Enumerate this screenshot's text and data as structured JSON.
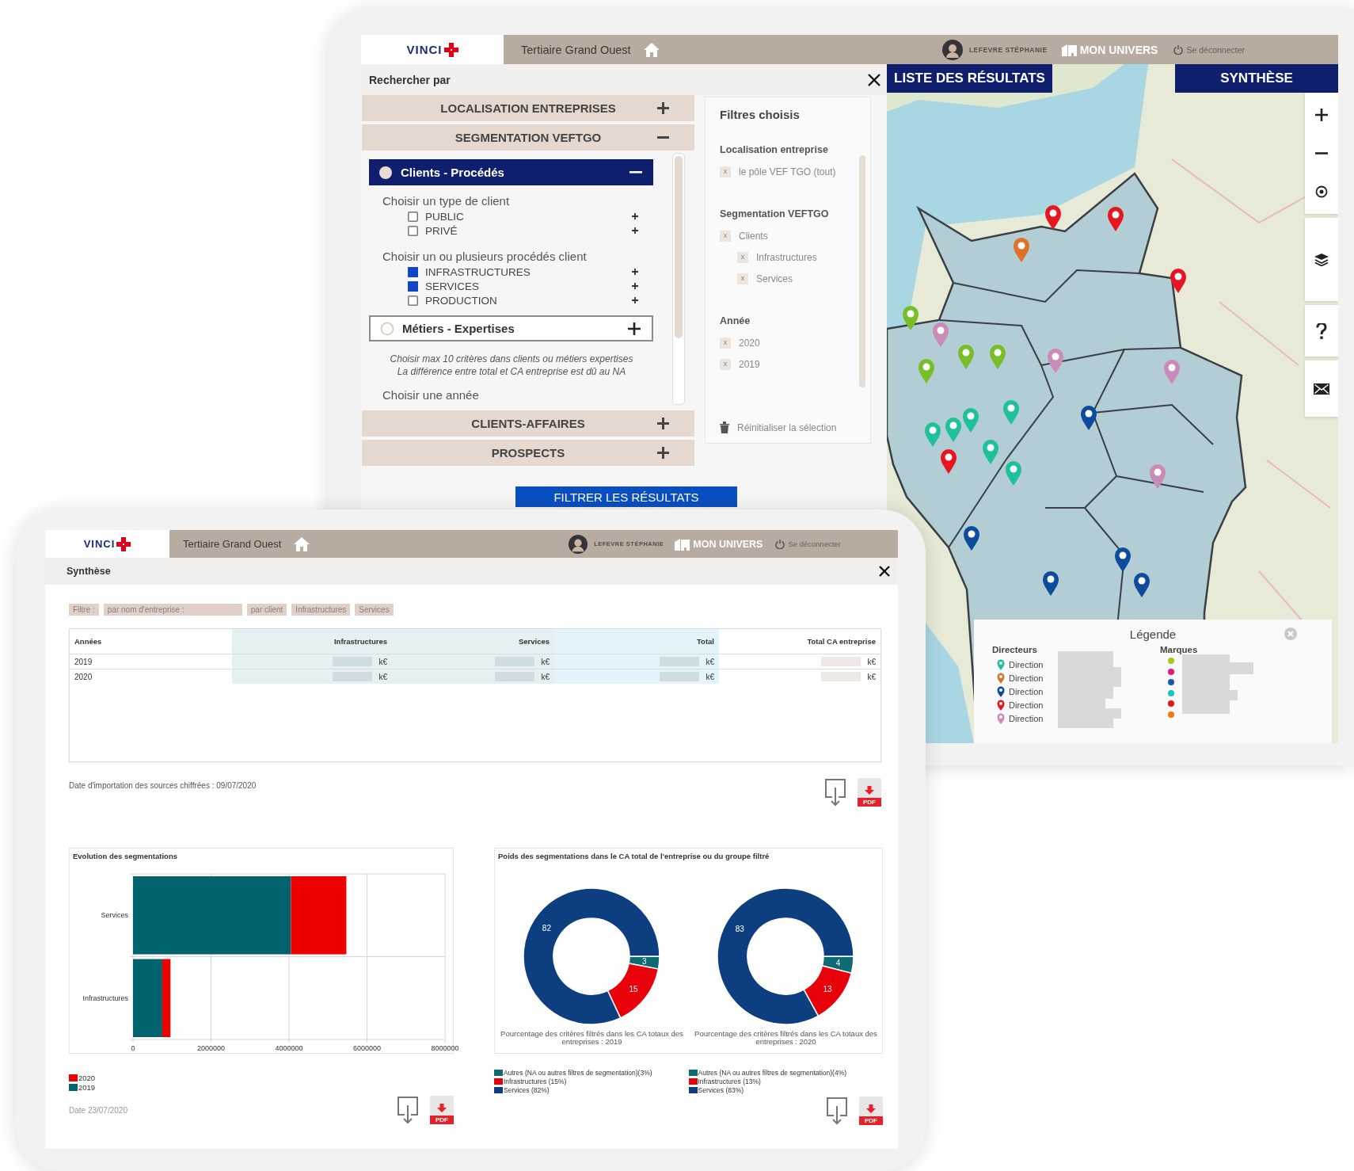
{
  "back_tablet": {
    "header": {
      "logo": "VINCI",
      "title": "Tertiaire Grand Ouest",
      "user": "LEFEVRE STÉPHANIE",
      "universe": "MON UNIVERS",
      "logout": "Se déconnecter"
    },
    "search_panel": {
      "title": "Rechercher par",
      "sections": [
        {
          "label": "LOCALISATION ENTREPRISES",
          "expanded": false
        },
        {
          "label": "SEGMENTATION VEFTGO",
          "expanded": true,
          "groups": [
            {
              "label": "Clients - Procédés",
              "selected": true,
              "expanded": true,
              "fields": [
                {
                  "label": "Choisir un type de client",
                  "options": [
                    {
                      "label": "PUBLIC",
                      "checked": false
                    },
                    {
                      "label": "PRIVÉ",
                      "checked": false
                    }
                  ]
                },
                {
                  "label": "Choisir un ou plusieurs procédés client",
                  "options": [
                    {
                      "label": "INFRASTRUCTURES",
                      "checked": true
                    },
                    {
                      "label": "SERVICES",
                      "checked": true
                    },
                    {
                      "label": "PRODUCTION",
                      "checked": false
                    }
                  ]
                }
              ]
            },
            {
              "label": "Métiers - Expertises",
              "selected": false,
              "expanded": false
            }
          ],
          "note": [
            "Choisir max 10 critères dans clients ou métiers expertises",
            "La différence entre total et CA entreprise est dû au NA"
          ],
          "next_field": "Choisir une année"
        },
        {
          "label": "CLIENTS-AFFAIRES",
          "expanded": false
        },
        {
          "label": "PROSPECTS",
          "expanded": false
        }
      ],
      "filter_button": "FILTRER LES RÉSULTATS"
    },
    "chosen_filters": {
      "title": "Filtres choisis",
      "groups": [
        {
          "label": "Localisation entreprise",
          "items": [
            {
              "remove": "x",
              "label": "le pôle VEF TGO (tout)"
            }
          ]
        },
        {
          "label": "Segmentation VEFTGO",
          "items": [
            {
              "remove": "x",
              "label": "Clients",
              "children": [
                {
                  "remove": "x",
                  "label": "Infrastructures"
                },
                {
                  "remove": "x",
                  "label": "Services"
                }
              ]
            }
          ]
        },
        {
          "label": "Année",
          "items": [
            {
              "remove": "x",
              "label": "2020"
            },
            {
              "remove": "x",
              "label": "2019"
            }
          ]
        }
      ],
      "reset": "Réinitialiser la sélection"
    },
    "map": {
      "tabs": [
        {
          "label": "LISTE DES RÉSULTATS"
        },
        {
          "label": "SYNTHÈSE"
        }
      ],
      "pins": [
        {
          "color": "#e0702a"
        },
        {
          "color": "#e8141f"
        },
        {
          "color": "#e8141f"
        },
        {
          "color": "#e8141f"
        },
        {
          "color": "#c98bb8"
        },
        {
          "color": "#c98bb8"
        },
        {
          "color": "#c98bb8"
        },
        {
          "color": "#c98bb8"
        },
        {
          "color": "#78be28"
        },
        {
          "color": "#78be28"
        },
        {
          "color": "#78be28"
        },
        {
          "color": "#78be28"
        },
        {
          "color": "#1fc19b"
        },
        {
          "color": "#1fc19b"
        },
        {
          "color": "#1fc19b"
        },
        {
          "color": "#1fc19b"
        },
        {
          "color": "#1fc19b"
        },
        {
          "color": "#1fc19b"
        },
        {
          "color": "#e8141f"
        },
        {
          "color": "#0d4b9c"
        },
        {
          "color": "#0d4b9c"
        },
        {
          "color": "#0d4b9c"
        },
        {
          "color": "#0d4b9c"
        },
        {
          "color": "#0d4b9c"
        }
      ],
      "legend": {
        "title": "Légende",
        "directors_title": "Directeurs",
        "directors": [
          {
            "label": "Direction",
            "color": "#1fc19b"
          },
          {
            "label": "Direction",
            "color": "#e0702a"
          },
          {
            "label": "Direction",
            "color": "#0d4b9c"
          },
          {
            "label": "Direction",
            "color": "#e8141f"
          },
          {
            "label": "Direction",
            "color": "#c98bb8"
          }
        ],
        "brands_title": "Marques",
        "brands": [
          {
            "color": "#a8c81c"
          },
          {
            "color": "#e0187f"
          },
          {
            "color": "#1a55b0"
          },
          {
            "color": "#1ac4c4"
          },
          {
            "color": "#e8141f"
          },
          {
            "color": "#f07a12"
          }
        ]
      }
    }
  },
  "front_tablet": {
    "header": {
      "logo": "VINCI",
      "title": "Tertiaire Grand Ouest",
      "user": "LEFEVRE STÉPHANIE",
      "universe": "MON UNIVERS",
      "logout": "Se déconnecter"
    },
    "panel_title": "Synthèse",
    "filters": [
      "Filtre :",
      "par nom d'entreprise :",
      "par client",
      "Infrastructures",
      "Services"
    ],
    "table": {
      "columns": [
        "Années",
        "Infrastructures",
        "Services",
        "Total",
        "Total CA entreprise"
      ],
      "rows": [
        {
          "cells": [
            "2019",
            "k€",
            "k€",
            "k€",
            "k€"
          ]
        },
        {
          "cells": [
            "2020",
            "k€",
            "k€",
            "k€",
            "k€"
          ]
        }
      ]
    },
    "import_date": "Date d'importation des sources chiffrées : 09/07/2020",
    "exports": [
      {
        "kind": "download"
      },
      {
        "kind": "pdf",
        "label": "PDF"
      }
    ],
    "bar_panel": {
      "chart_data": {
        "type": "bar",
        "title": "Evolution des segmentations",
        "orientation": "horizontal",
        "stacked": true,
        "categories": [
          "Services",
          "Infrastructures"
        ],
        "series": [
          {
            "name": "2019",
            "color": "#00636e",
            "values": [
              4050000,
              750000
            ]
          },
          {
            "name": "2020",
            "color": "#ee0000",
            "values": [
              1420000,
              210000
            ]
          }
        ],
        "xlim": [
          0,
          8000000
        ],
        "xticks": [
          0,
          2000000,
          4000000,
          6000000,
          8000000
        ],
        "grid": true
      },
      "date": "Date 23/07/2020",
      "exports": [
        {
          "kind": "download"
        },
        {
          "kind": "pdf",
          "label": "PDF"
        }
      ]
    },
    "donut_panel": {
      "title": "Poids des segmentations dans le CA total de l'entreprise ou du groupe filtré",
      "donuts": [
        {
          "chart_data": {
            "type": "donut",
            "title": "Pourcentage des critères filtrés dans les CA totaux des entreprises : 2019",
            "values": [
              3,
              15,
              82
            ],
            "data_labels": true
          },
          "legend": [
            {
              "label": "Autres (NA ou autres filtres de segmentation)(3%)",
              "color": "#0e6a73"
            },
            {
              "label": "Infrastructures (15%)",
              "color": "#e8000b"
            },
            {
              "label": "Services (82%)",
              "color": "#0d3f80"
            }
          ]
        },
        {
          "chart_data": {
            "type": "donut",
            "title": "Pourcentage des critères filtrés dans les CA totaux des entreprises : 2020",
            "values": [
              4,
              13,
              83
            ],
            "data_labels": true
          },
          "legend": [
            {
              "label": "Autres (NA ou autres filtres de segmentation)(4%)",
              "color": "#0e6a73"
            },
            {
              "label": "Infrastructures (13%)",
              "color": "#e8000b"
            },
            {
              "label": "Services (83%)",
              "color": "#0d3f80"
            }
          ]
        }
      ],
      "exports": [
        {
          "kind": "download"
        },
        {
          "kind": "pdf",
          "label": "PDF"
        }
      ]
    }
  }
}
